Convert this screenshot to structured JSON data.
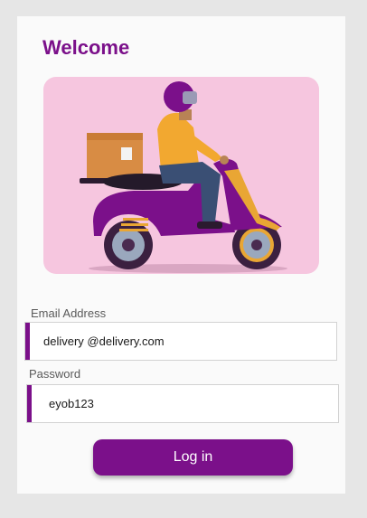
{
  "header": {
    "title": "Welcome"
  },
  "hero": {
    "illustration": "delivery-scooter-rider"
  },
  "form": {
    "email": {
      "label": "Email Address",
      "value": "delivery @delivery.com"
    },
    "password": {
      "label": "Password",
      "value": "eyob123"
    },
    "login_label": "Log in"
  },
  "colors": {
    "accent": "#7b108a",
    "hero_bg": "#f6c6df",
    "page_bg": "#e6e6e6",
    "card_bg": "#fafafa"
  }
}
